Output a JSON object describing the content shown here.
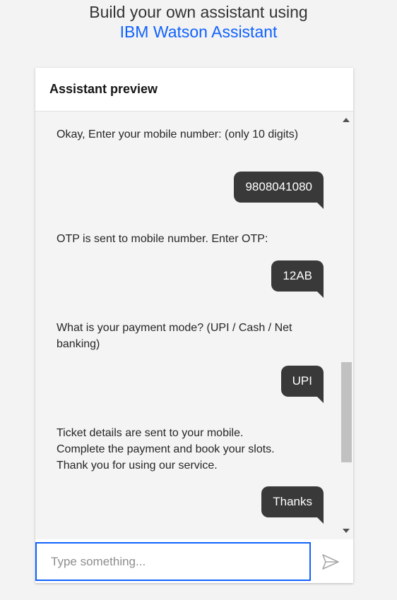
{
  "header": {
    "line1": "Build your own assistant using",
    "link": "IBM Watson Assistant"
  },
  "panel": {
    "title": "Assistant preview"
  },
  "messages": [
    {
      "from": "bot",
      "text": "Okay, Enter your mobile number: (only 10 digits)"
    },
    {
      "from": "user",
      "text": "9808041080"
    },
    {
      "from": "bot",
      "text": "OTP is sent to mobile number. Enter OTP:"
    },
    {
      "from": "user",
      "text": "12AB"
    },
    {
      "from": "bot",
      "text": "What is your payment mode? (UPI / Cash / Net banking)"
    },
    {
      "from": "user",
      "text": "UPI"
    },
    {
      "from": "bot",
      "text": "Ticket details are sent to your mobile.\nComplete the payment and book your slots.\nThank you for using our service."
    },
    {
      "from": "user",
      "text": "Thanks"
    }
  ],
  "input": {
    "placeholder": "Type something...",
    "value": ""
  },
  "colors": {
    "accent": "#0f62fe",
    "user_bubble": "#393939",
    "chat_bg": "#f4f4f4"
  },
  "icons": {
    "send": "send-icon"
  }
}
